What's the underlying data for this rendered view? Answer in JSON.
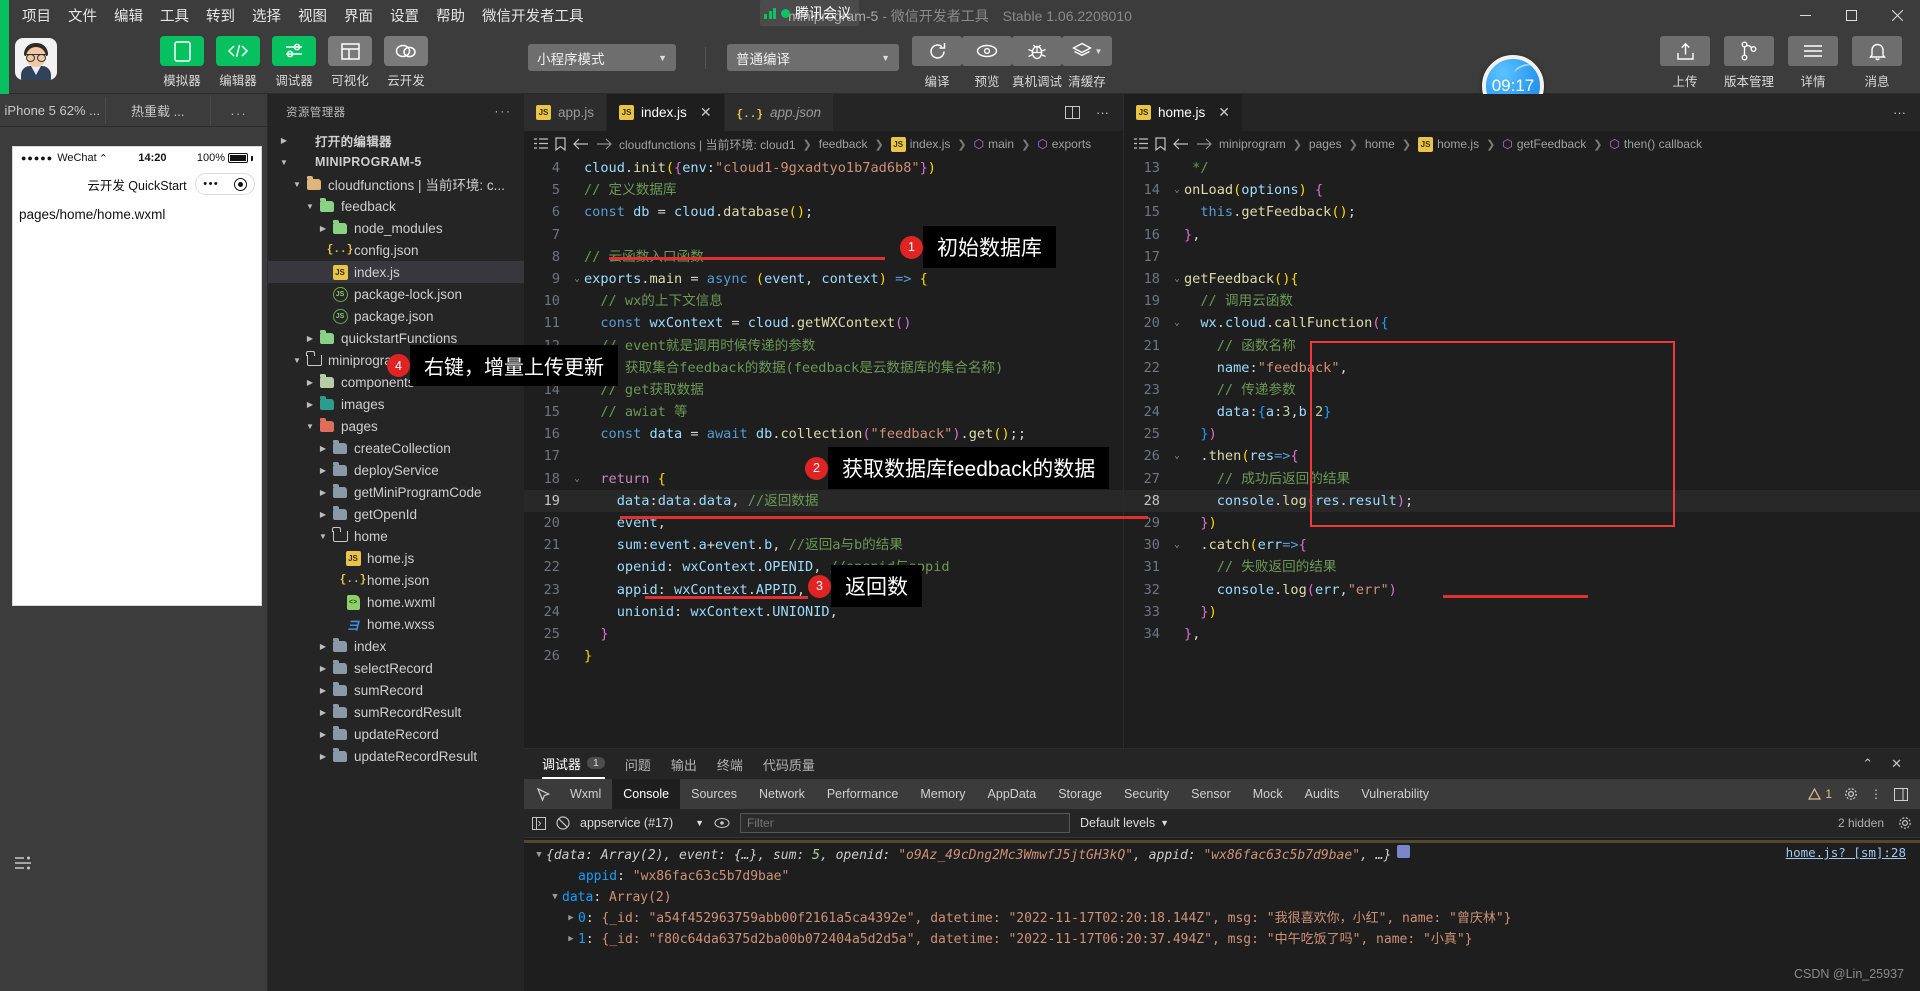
{
  "titlebar": {
    "menus": [
      "项目",
      "文件",
      "编辑",
      "工具",
      "转到",
      "选择",
      "视图",
      "界面",
      "设置",
      "帮助",
      "微信开发者工具"
    ],
    "project_title": "miniprogram-5",
    "title_sub": " - 微信开发者工具",
    "version": "Stable 1.06.2208010",
    "tencent_label": "腾讯会议",
    "window_buttons": {
      "minimize": "—",
      "maximize": "▢",
      "close": "✕"
    }
  },
  "toolbar": {
    "left_buttons": [
      {
        "label": "模拟器",
        "icon": "phone-icon",
        "style": "green"
      },
      {
        "label": "编辑器",
        "icon": "code-icon",
        "style": "green"
      },
      {
        "label": "调试器",
        "icon": "sliders-icon",
        "style": "green"
      },
      {
        "label": "可视化",
        "icon": "layout-icon",
        "style": "gray"
      },
      {
        "label": "云开发",
        "icon": "cloud-icon",
        "style": "gray"
      }
    ],
    "mode_select": "小程序模式",
    "compile_select": "普通编译",
    "action_buttons": [
      {
        "label": "编译",
        "icon": "refresh-icon"
      },
      {
        "label": "预览",
        "icon": "eye-icon"
      },
      {
        "label": "真机调试",
        "icon": "bug-icon"
      },
      {
        "label": "清缓存",
        "icon": "layers-icon"
      }
    ],
    "clock": "09:17",
    "right_buttons": [
      {
        "label": "上传",
        "icon": "upload-icon"
      },
      {
        "label": "版本管理",
        "icon": "branch-icon"
      },
      {
        "label": "详情",
        "icon": "menu-icon"
      },
      {
        "label": "消息",
        "icon": "bell-icon"
      }
    ]
  },
  "simulator": {
    "tabs": [
      "iPhone 5 62% ...",
      "热重载 ...",
      "..."
    ],
    "status": {
      "carrier": "WeChat",
      "time": "14:20",
      "battery": "100%"
    },
    "nav_title": "云开发 QuickStart",
    "page_path": "pages/home/home.wxml"
  },
  "explorer": {
    "title": "资源管理器",
    "tree": [
      {
        "label": "打开的编辑器",
        "depth": 0,
        "arrow": "right",
        "icon": "none",
        "bold": true
      },
      {
        "label": "MINIPROGRAM-5",
        "depth": 0,
        "arrow": "down",
        "icon": "none",
        "bold": true
      },
      {
        "label": "cloudfunctions | 当前环境: c...",
        "depth": 1,
        "arrow": "down",
        "icon": "folder-yellow"
      },
      {
        "label": "feedback",
        "depth": 2,
        "arrow": "down",
        "icon": "folder-green"
      },
      {
        "label": "node_modules",
        "depth": 3,
        "arrow": "right",
        "icon": "folder-green"
      },
      {
        "label": "config.json",
        "depth": 3,
        "arrow": "none",
        "icon": "json"
      },
      {
        "label": "index.js",
        "depth": 3,
        "arrow": "none",
        "icon": "js",
        "selected": true
      },
      {
        "label": "package-lock.json",
        "depth": 3,
        "arrow": "none",
        "icon": "node"
      },
      {
        "label": "package.json",
        "depth": 3,
        "arrow": "none",
        "icon": "node"
      },
      {
        "label": "quickstartFunctions",
        "depth": 2,
        "arrow": "right",
        "icon": "folder-green"
      },
      {
        "label": "miniprogram",
        "depth": 1,
        "arrow": "down",
        "icon": "folder-open"
      },
      {
        "label": "components",
        "depth": 2,
        "arrow": "right",
        "icon": "folder-ylgreen"
      },
      {
        "label": "images",
        "depth": 2,
        "arrow": "right",
        "icon": "folder-teal"
      },
      {
        "label": "pages",
        "depth": 2,
        "arrow": "down",
        "icon": "folder-red"
      },
      {
        "label": "createCollection",
        "depth": 3,
        "arrow": "right",
        "icon": "folder-gray"
      },
      {
        "label": "deployService",
        "depth": 3,
        "arrow": "right",
        "icon": "folder-gray"
      },
      {
        "label": "getMiniProgramCode",
        "depth": 3,
        "arrow": "right",
        "icon": "folder-gray"
      },
      {
        "label": "getOpenId",
        "depth": 3,
        "arrow": "right",
        "icon": "folder-gray"
      },
      {
        "label": "home",
        "depth": 3,
        "arrow": "down",
        "icon": "folder-open"
      },
      {
        "label": "home.js",
        "depth": 4,
        "arrow": "none",
        "icon": "js"
      },
      {
        "label": "home.json",
        "depth": 4,
        "arrow": "none",
        "icon": "json"
      },
      {
        "label": "home.wxml",
        "depth": 4,
        "arrow": "none",
        "icon": "wxml"
      },
      {
        "label": "home.wxss",
        "depth": 4,
        "arrow": "none",
        "icon": "wxss"
      },
      {
        "label": "index",
        "depth": 3,
        "arrow": "right",
        "icon": "folder-gray"
      },
      {
        "label": "selectRecord",
        "depth": 3,
        "arrow": "right",
        "icon": "folder-gray"
      },
      {
        "label": "sumRecord",
        "depth": 3,
        "arrow": "right",
        "icon": "folder-gray"
      },
      {
        "label": "sumRecordResult",
        "depth": 3,
        "arrow": "right",
        "icon": "folder-gray"
      },
      {
        "label": "updateRecord",
        "depth": 3,
        "arrow": "right",
        "icon": "folder-gray"
      },
      {
        "label": "updateRecordResult",
        "depth": 3,
        "arrow": "right",
        "icon": "folder-gray"
      }
    ]
  },
  "editor_left": {
    "tabs": [
      {
        "label": "app.js",
        "icon": "js",
        "active": false,
        "closable": false
      },
      {
        "label": "index.js",
        "icon": "js",
        "active": true,
        "closable": true
      },
      {
        "label": "app.json",
        "icon": "json",
        "active": false,
        "closable": false,
        "italic": true
      }
    ],
    "breadcrumb": [
      "cloudfunctions | 当前环境: cloud1",
      "feedback",
      "index.js",
      "main",
      "exports"
    ],
    "first_line": 4,
    "lines": [
      {
        "n": 4,
        "html": "<span class='id'>cloud</span><span class='op'>.</span><span class='fn'>init</span><span class='yellowp'>(</span><span class='pinkp'>{</span><span class='id'>env</span><span class='op'>:</span><span class='str'>\"cloud1-9gxadtyo1b7ad6b8\"</span><span class='pinkp'>}</span><span class='yellowp'>)</span>"
      },
      {
        "n": 5,
        "html": "<span class='cm'>// 定义数据库</span>"
      },
      {
        "n": 6,
        "html": "<span class='kw'>const</span> <span class='id'>db</span> <span class='op'>=</span> <span class='id'>cloud</span><span class='op'>.</span><span class='fn'>database</span><span class='yellowp'>()</span><span class='op'>;</span>"
      },
      {
        "n": 7,
        "html": ""
      },
      {
        "n": 8,
        "html": "<span class='cm'>// 云函数入口函数</span>"
      },
      {
        "n": 9,
        "html": "<span class='id'>exports</span><span class='op'>.</span><span class='fn'>main</span> <span class='op'>=</span> <span class='kw'>async</span> <span class='yellowp'>(</span><span class='var'>event</span><span class='op'>,</span> <span class='var'>context</span><span class='yellowp'>)</span> <span class='kw'>=&gt;</span> <span class='yellowp'>{</span>",
        "fold": "down"
      },
      {
        "n": 10,
        "html": "  <span class='cm'>// wx的上下文信息</span>"
      },
      {
        "n": 11,
        "html": "  <span class='kw'>const</span> <span class='id'>wxContext</span> <span class='op'>=</span> <span class='id'>cloud</span><span class='op'>.</span><span class='fn'>getWXContext</span><span class='pinkp'>()</span>"
      },
      {
        "n": 12,
        "html": "  <span class='cm'>// event就是调用时候传递的参数</span>",
        "fold": "down"
      },
      {
        "n": 13,
        "html": "  <span class='cm'>// 获取集合feedback的数据(feedback是云数据库的集合名称)</span>"
      },
      {
        "n": 14,
        "html": "  <span class='cm'>// get获取数据</span>"
      },
      {
        "n": 15,
        "html": "  <span class='cm'>// awiat 等</span>"
      },
      {
        "n": 16,
        "html": "  <span class='kw'>const</span> <span class='id'>data</span> <span class='op'>=</span> <span class='kw'>await</span> <span class='id'>db</span><span class='op'>.</span><span class='fn'>collection</span><span class='pinkp'>(</span><span class='str'>\"feedback\"</span><span class='pinkp'>)</span><span class='op'>.</span><span class='fn'>get</span><span class='yellowp'>()</span><span class='op'>;;</span>"
      },
      {
        "n": 17,
        "html": ""
      },
      {
        "n": 18,
        "html": "  <span class='kw2'>return</span> <span class='yellowp'>{</span>",
        "fold": "down"
      },
      {
        "n": 19,
        "html": "    <span class='id'>data</span><span class='op'>:</span><span class='id'>data</span><span class='op'>.</span><span class='id'>data</span><span class='op'>,</span> <span class='cm'>//返回数据</span>",
        "current": true
      },
      {
        "n": 20,
        "html": "    <span class='id'>event</span><span class='op'>,</span>"
      },
      {
        "n": 21,
        "html": "    <span class='id'>sum</span><span class='op'>:</span><span class='id'>event</span><span class='op'>.</span><span class='id'>a</span><span class='op'>+</span><span class='id'>event</span><span class='op'>.</span><span class='id'>b</span><span class='op'>,</span> <span class='cm'>//返回a与b的结果</span>"
      },
      {
        "n": 22,
        "html": "    <span class='id'>openid</span><span class='op'>:</span> <span class='id'>wxContext</span><span class='op'>.</span><span class='id'>OPENID</span><span class='op'>,</span> <span class='cm'>//openid与appid</span>"
      },
      {
        "n": 23,
        "html": "    <span class='id'>appid</span><span class='op'>:</span> <span class='id'>wxContext</span><span class='op'>.</span><span class='id'>APPID</span><span class='op'>,</span>"
      },
      {
        "n": 24,
        "html": "    <span class='id'>unionid</span><span class='op'>:</span> <span class='id'>wxContext</span><span class='op'>.</span><span class='id'>UNIONID</span><span class='op'>,</span>"
      },
      {
        "n": 25,
        "html": "  <span class='pinkp'>}</span>"
      },
      {
        "n": 26,
        "html": "<span class='yellowp'>}</span>"
      }
    ]
  },
  "editor_right": {
    "tabs": [
      {
        "label": "home.js",
        "icon": "js",
        "active": true,
        "closable": true
      }
    ],
    "breadcrumb": [
      "miniprogram",
      "pages",
      "home",
      "home.js",
      "getFeedback",
      "then() callback"
    ],
    "lines": [
      {
        "n": 13,
        "html": "<span class='cm'> */</span>"
      },
      {
        "n": 14,
        "html": "<span class='fn'>onLoad</span><span class='yellowp'>(</span><span class='var'>options</span><span class='yellowp'>)</span> <span class='pinkp'>{</span>",
        "fold": "down"
      },
      {
        "n": 15,
        "html": "  <span class='kw'>this</span><span class='op'>.</span><span class='fn'>getFeedback</span><span class='yellowp'>()</span><span class='op'>;</span>"
      },
      {
        "n": 16,
        "html": "<span class='pinkp'>}</span><span class='op'>,</span>"
      },
      {
        "n": 17,
        "html": ""
      },
      {
        "n": 18,
        "html": "<span class='fn'>getFeedback</span><span class='yellowp'>(){</span>",
        "fold": "down"
      },
      {
        "n": 19,
        "html": "  <span class='cm'>// 调用云函数</span>"
      },
      {
        "n": 20,
        "html": "  <span class='id'>wx</span><span class='op'>.</span><span class='id'>cloud</span><span class='op'>.</span><span class='fn'>callFunction</span><span class='pinkp'>(</span><span class='bluep'>{</span>",
        "fold": "down"
      },
      {
        "n": 21,
        "html": "    <span class='cm'>// 函数名称</span>"
      },
      {
        "n": 22,
        "html": "    <span class='id'>name</span><span class='op'>:</span><span class='str'>\"feedback\"</span><span class='op'>,</span>"
      },
      {
        "n": 23,
        "html": "    <span class='cm'>// 传递参数</span>"
      },
      {
        "n": 24,
        "html": "    <span class='id'>data</span><span class='op'>:</span><span class='bluep'>{</span><span class='id'>a</span><span class='op'>:</span><span class='num'>3</span><span class='op'>,</span><span class='id'>b</span><span class='op'>:</span><span class='num'>2</span><span class='bluep'>}</span>"
      },
      {
        "n": 25,
        "html": "  <span class='bluep'>}</span><span class='pinkp'>)</span>"
      },
      {
        "n": 26,
        "html": "  <span class='op'>.</span><span class='fn'>then</span><span class='yellowp'>(</span><span class='var'>res</span><span class='kw'>=&gt;</span><span class='pinkp'>{</span>",
        "fold": "down"
      },
      {
        "n": 27,
        "html": "    <span class='cm'>// 成功后返回的结果</span>"
      },
      {
        "n": 28,
        "html": "    <span class='id'>console</span><span class='op'>.</span><span class='fn'>log</span><span class='pinkp'>(</span><span class='var'>res</span><span class='op'>.</span><span class='id'>result</span><span class='pinkp'>)</span><span class='op'>;</span>",
        "current": true
      },
      {
        "n": 29,
        "html": "  <span class='pinkp'>}</span><span class='yellowp'>)</span>"
      },
      {
        "n": 30,
        "html": "  <span class='op'>.</span><span class='fn'>catch</span><span class='yellowp'>(</span><span class='var'>err</span><span class='kw'>=&gt;</span><span class='pinkp'>{</span>",
        "fold": "down"
      },
      {
        "n": 31,
        "html": "    <span class='cm'>// 失败返回的结果</span>"
      },
      {
        "n": 32,
        "html": "    <span class='id'>console</span><span class='op'>.</span><span class='fn'>log</span><span class='pinkp'>(</span><span class='var'>err</span><span class='op'>,</span><span class='str'>\"err\"</span><span class='pinkp'>)</span>"
      },
      {
        "n": 33,
        "html": "  <span class='pinkp'>}</span><span class='yellowp'>)</span>"
      },
      {
        "n": 34,
        "html": "<span class='pinkp'>}</span><span class='op'>,</span>"
      }
    ]
  },
  "callouts": [
    {
      "num": "1",
      "text": "初始数据库"
    },
    {
      "num": "2",
      "text": "获取数据库feedback的数据"
    },
    {
      "num": "3",
      "text": "返回数"
    },
    {
      "num": "4",
      "text": "右键，增量上传更新"
    }
  ],
  "console": {
    "panel_tabs": [
      {
        "label": "调试器",
        "badge": "1",
        "active": true
      },
      {
        "label": "问题",
        "active": false
      },
      {
        "label": "输出",
        "active": false
      },
      {
        "label": "终端",
        "active": false
      },
      {
        "label": "代码质量",
        "active": false
      }
    ],
    "panel_actions": {
      "collapse": "⌃",
      "close": "✕"
    },
    "devtools_tabs": [
      "Wxml",
      "Console",
      "Sources",
      "Network",
      "Performance",
      "Memory",
      "AppData",
      "Storage",
      "Security",
      "Sensor",
      "Mock",
      "Audits",
      "Vulnerability"
    ],
    "devtools_active": "Console",
    "warning_count": "1",
    "filter": {
      "source": "appservice (#17)",
      "placeholder": "Filter",
      "levels": "Default levels",
      "hidden": "2 hidden"
    },
    "log": {
      "summary_prefix": "{data: Array(2), event: {…}, sum: ",
      "summary_sum": "5",
      "summary_mid": ", openid: ",
      "summary_openid": "\"o9Az_49cDng2Mc3WmwfJ5jtGH3kQ\"",
      "summary_mid2": ", appid: ",
      "summary_appid": "\"wx86fac63c5b7d9bae\"",
      "summary_end": ", …}",
      "source_link": "home.js? [sm]:28",
      "rows": [
        {
          "key": "appid",
          "value": "\"wx86fac63c5b7d9bae\"",
          "indent": 2,
          "tri": ""
        },
        {
          "key": "data",
          "value": "Array(2)",
          "indent": 1,
          "tri": "▼"
        },
        {
          "key": "0",
          "value": "{_id: \"a54f452963759abb00f2161a5ca4392e\", datetime: \"2022-11-17T02:20:18.144Z\", msg: \"我很喜欢你，小红\", name: \"曾庆林\"}",
          "indent": 2,
          "tri": "▶"
        },
        {
          "key": "1",
          "value": "{_id: \"f80c64da6375d2ba00b072404a5d2d5a\", datetime: \"2022-11-17T06:20:37.494Z\", msg: \"中午吃饭了吗\", name: \"小真\"}",
          "indent": 2,
          "tri": "▶"
        }
      ]
    },
    "watermark": "CSDN @Lin_25937"
  }
}
